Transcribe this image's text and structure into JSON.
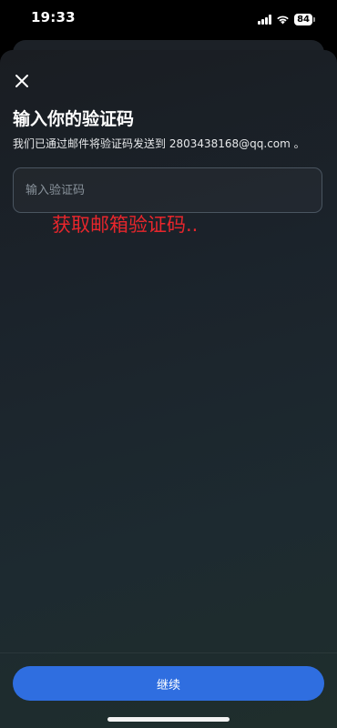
{
  "status_bar": {
    "time": "19:33",
    "battery_level": "84",
    "icons": [
      "signal-icon",
      "wifi-icon",
      "battery-icon"
    ]
  },
  "sheet": {
    "close_icon": "close-icon",
    "title": "输入你的验证码",
    "subtitle": "我们已通过邮件将验证码发送到 2803438168@qq.com 。",
    "code_input": {
      "placeholder": "输入验证码",
      "value": ""
    },
    "annotation": "获取邮箱验证码..",
    "continue_label": "继续"
  },
  "colors": {
    "accent": "#2f6ee0",
    "annotation": "#e8262c",
    "background": "#1b232b"
  }
}
